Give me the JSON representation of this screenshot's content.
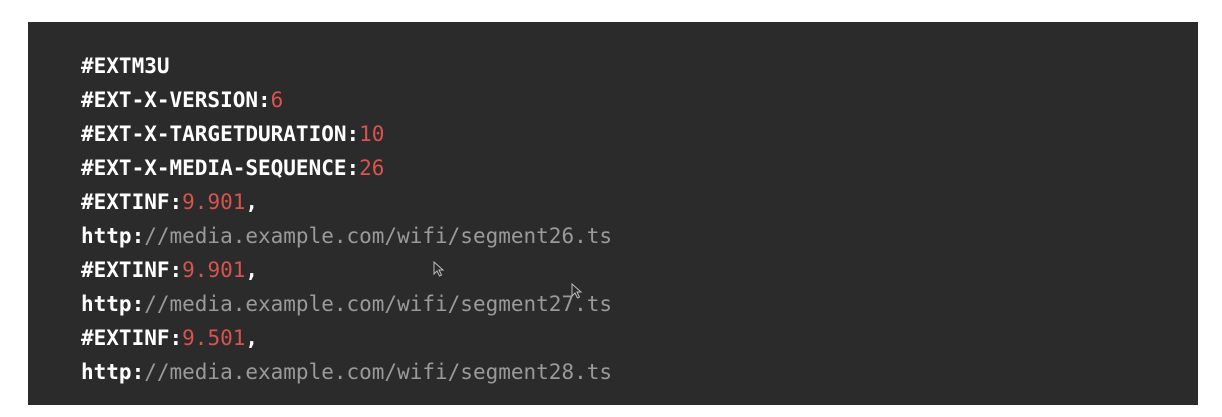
{
  "code": {
    "lines": [
      {
        "tag": "#EXTM3U",
        "value": "",
        "suffix": ""
      },
      {
        "tag": "#EXT-X-VERSION:",
        "value": "6",
        "suffix": ""
      },
      {
        "tag": "#EXT-X-TARGETDURATION:",
        "value": "10",
        "suffix": ""
      },
      {
        "tag": "#EXT-X-MEDIA-SEQUENCE:",
        "value": "26",
        "suffix": ""
      },
      {
        "tag": "#EXTINF:",
        "value": "9.901",
        "suffix": ","
      },
      {
        "scheme": "http:",
        "rest": "//media.example.com/wifi/segment26.ts"
      },
      {
        "tag": "#EXTINF:",
        "value": "9.901",
        "suffix": ","
      },
      {
        "scheme": "http:",
        "rest": "//media.example.com/wifi/segment27.ts"
      },
      {
        "tag": "#EXTINF:",
        "value": "9.501",
        "suffix": ","
      },
      {
        "scheme": "http:",
        "rest": "//media.example.com/wifi/segment28.ts"
      }
    ]
  },
  "colors": {
    "background": "#2b2b2b",
    "tag": "#ffffff",
    "number": "#d9534f",
    "url": "#9a9a9a"
  },
  "icons": [
    "mouse-pointer-icon",
    "mouse-pointer-icon"
  ]
}
